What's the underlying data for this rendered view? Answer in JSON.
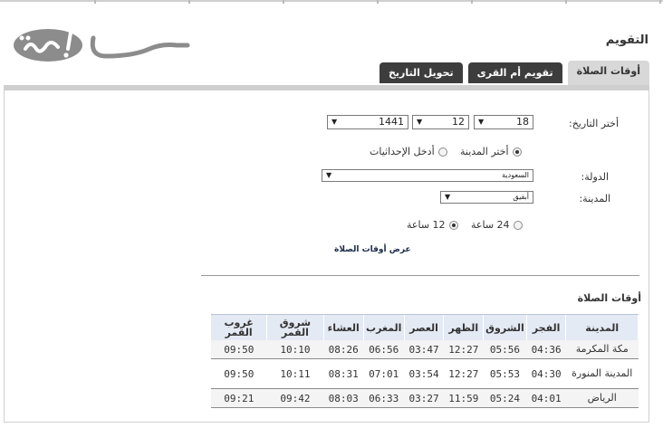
{
  "header": {
    "page_title": "التقويم"
  },
  "tabs": [
    {
      "label": "أوقات الصلاة",
      "active": true
    },
    {
      "label": "تقويم أم القرى",
      "active": false
    },
    {
      "label": "تحويل التاريخ",
      "active": false
    }
  ],
  "form": {
    "date_label": "أختر التاريخ:",
    "day": "18",
    "month": "12",
    "year": "1441",
    "mode_city": "أختر المدينة",
    "mode_coords": "أدخل الإحداثيات",
    "country_label": "الدولة:",
    "country_value": "السعودية",
    "city_label": "المدينة:",
    "city_value": "أبقيق",
    "format_24": "24 ساعة",
    "format_12": "12 ساعة",
    "show_button": "عرض أوقات الصلاة"
  },
  "results": {
    "title": "أوقات الصلاة",
    "columns": [
      "المدينة",
      "الفجر",
      "الشروق",
      "الظهر",
      "العصر",
      "المغرب",
      "العشاء",
      "شروق القمر",
      "غروب القمر"
    ],
    "rows": [
      [
        "مكة المكرمة",
        "04:36",
        "05:56",
        "12:27",
        "03:47",
        "06:56",
        "08:26",
        "10:10",
        "09:50"
      ],
      [
        "المدينة المنورة",
        "04:30",
        "05:53",
        "12:27",
        "03:54",
        "07:01",
        "08:31",
        "10:11",
        "09:50"
      ],
      [
        "الرياض",
        "04:01",
        "05:24",
        "11:59",
        "03:27",
        "06:33",
        "08:03",
        "09:42",
        "09:21"
      ]
    ]
  },
  "colors": {
    "tab_dark": "#3d3d3d",
    "tab_active": "#d8d8d8",
    "table_header": "#e4eaf4"
  }
}
